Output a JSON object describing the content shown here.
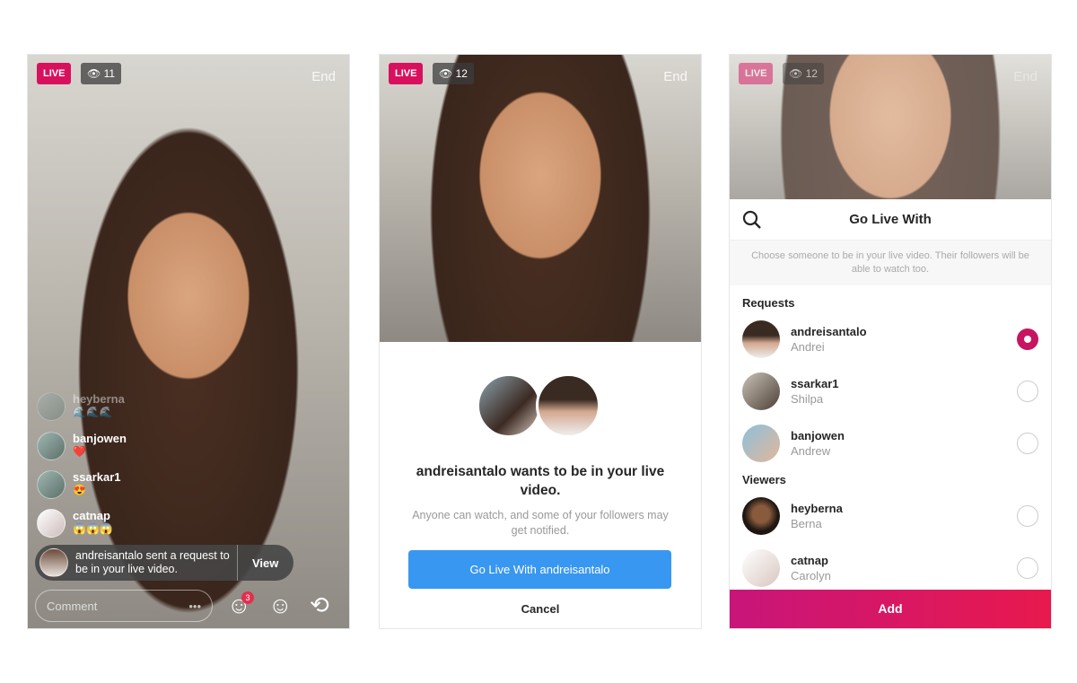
{
  "status": {
    "live": "LIVE",
    "end": "End"
  },
  "panel1": {
    "viewers": "11",
    "comments": [
      {
        "user": "heyberna",
        "text": "🌊🌊🌊"
      },
      {
        "user": "banjowen",
        "text": "❤️"
      },
      {
        "user": "ssarkar1",
        "text": "😍"
      },
      {
        "user": "catnap",
        "text": "😱😱😱"
      }
    ],
    "request_text": "andreisantalo sent a request to be in your live video.",
    "view": "View",
    "comment_placeholder": "Comment",
    "more": "•••",
    "request_count": "3",
    "icons": [
      "guests-icon",
      "face-filter-icon",
      "flip-camera-icon"
    ]
  },
  "panel2": {
    "viewers": "12",
    "title": "andreisantalo wants to be in your live video.",
    "subtitle": "Anyone can watch, and some of your followers may get notified.",
    "go_live": "Go Live With andreisantalo",
    "cancel": "Cancel"
  },
  "panel3": {
    "viewers": "12",
    "title": "Go Live With",
    "description": "Choose someone to be in your live video. Their followers will be able to watch too.",
    "requests_label": "Requests",
    "viewers_label": "Viewers",
    "requests": [
      {
        "user": "andreisantalo",
        "name": "Andrei",
        "selected": true
      },
      {
        "user": "ssarkar1",
        "name": "Shilpa",
        "selected": false
      },
      {
        "user": "banjowen",
        "name": "Andrew",
        "selected": false
      }
    ],
    "viewers_list": [
      {
        "user": "heyberna",
        "name": "Berna",
        "selected": false
      },
      {
        "user": "catnap",
        "name": "Carolyn",
        "selected": false
      }
    ],
    "add": "Add"
  },
  "colors": {
    "live": "#d8115f",
    "primary": "#3897f0",
    "add_gradient": [
      "#c8157a",
      "#e8194d"
    ]
  }
}
